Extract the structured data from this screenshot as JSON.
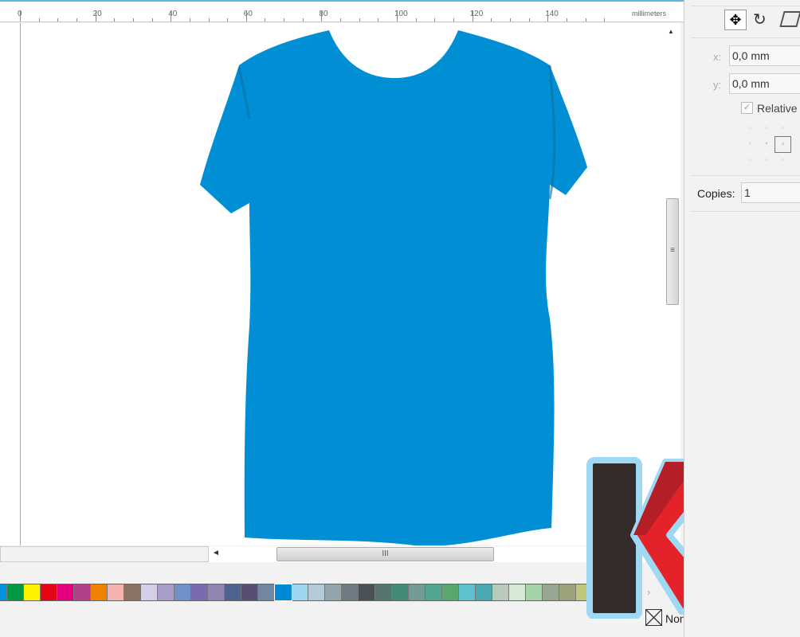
{
  "ruler": {
    "unit": "millimeters",
    "ticks": [
      "0",
      "20",
      "40",
      "60",
      "80",
      "100",
      "120",
      "140"
    ]
  },
  "canvas": {
    "shape_color": "#008fd5",
    "vthumb": "≡",
    "hthumb": "III",
    "pager_arrow": "◄"
  },
  "palette": [
    "#0096df",
    "#009a44",
    "#fff200",
    "#e30613",
    "#e4007f",
    "#b0428a",
    "#ef8200",
    "#f4b3b1",
    "#8a7265",
    "#d2cfe6",
    "#a89ccb",
    "#7090c8",
    "#7b6aad",
    "#8f85b0",
    "#4d6490",
    "#584e72",
    "#7186a0",
    "#0089d8",
    "#9dd5f3",
    "#b5cad8",
    "#94a4ac",
    "#6e7b82",
    "#4a5258",
    "#557670",
    "#428a78",
    "#739b96",
    "#52a690",
    "#5ba66d",
    "#5ec1cf",
    "#4aa8b2",
    "#b8cab8",
    "#d4ead5",
    "#a3d4a7",
    "#96a690",
    "#9aa37a",
    "#bfc77a",
    "#d8e08a"
  ],
  "panel": {
    "x_label": "x:",
    "x_value": "0,0 mm",
    "y_label": "y:",
    "y_value": "0,0 mm",
    "relative_label": "Relative",
    "copies_label": "Copies:",
    "copies_value": "1"
  },
  "status": {
    "fill_none": "None"
  }
}
